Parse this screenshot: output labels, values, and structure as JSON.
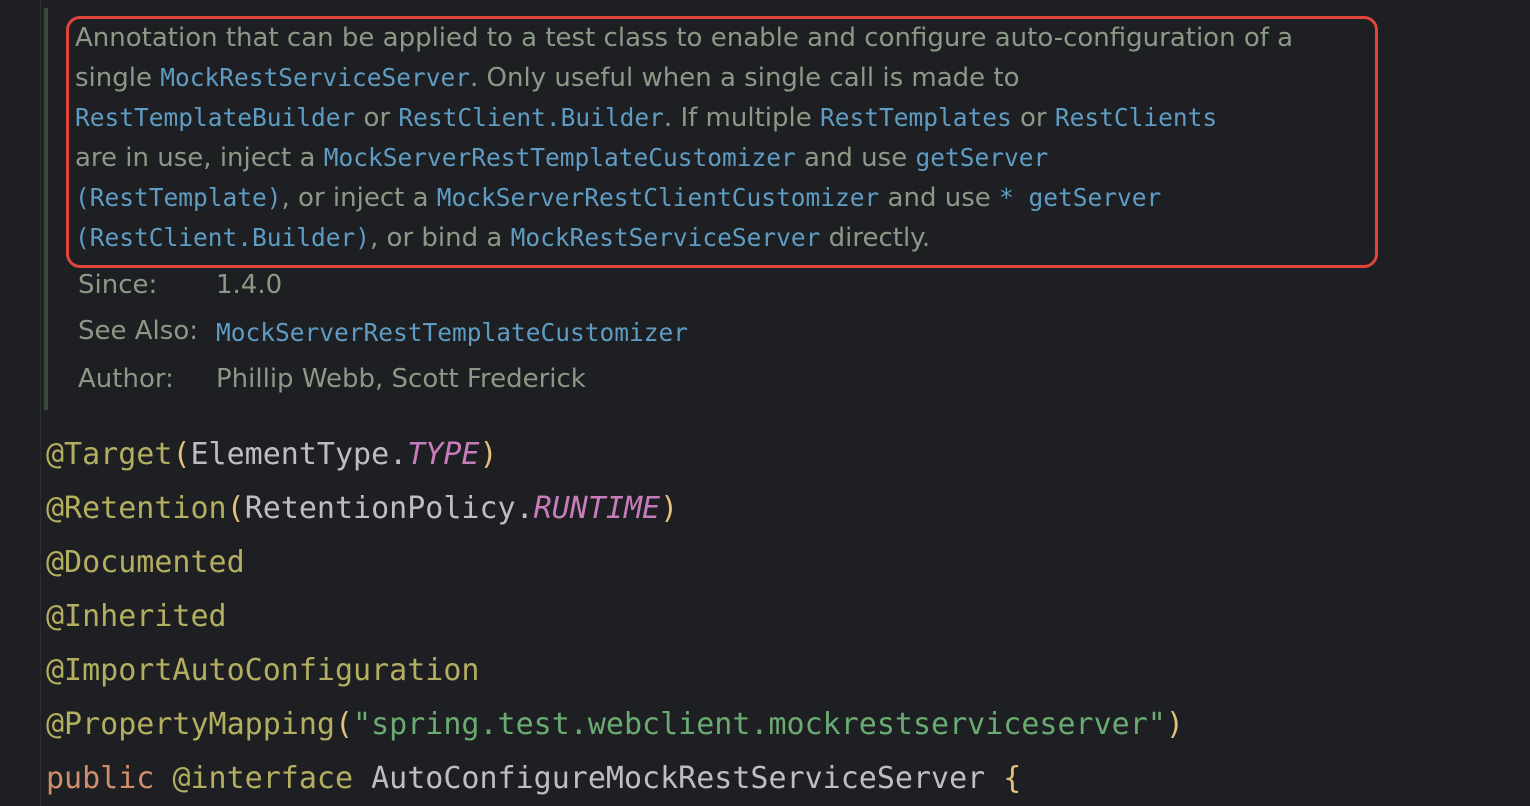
{
  "javadoc": {
    "lines": [
      [
        {
          "t": "Annotation that can be applied to a test class to enable and configure auto-configuration of a",
          "k": "text"
        }
      ],
      [
        {
          "t": "single ",
          "k": "text"
        },
        {
          "t": "MockRestServiceServer",
          "k": "code"
        },
        {
          "t": ". Only useful when a single call is made to",
          "k": "text"
        }
      ],
      [
        {
          "t": "RestTemplateBuilder",
          "k": "code"
        },
        {
          "t": " or ",
          "k": "text"
        },
        {
          "t": "RestClient.Builder",
          "k": "code"
        },
        {
          "t": ". If multiple ",
          "k": "text"
        },
        {
          "t": "RestTemplates",
          "k": "code"
        },
        {
          "t": " or ",
          "k": "text"
        },
        {
          "t": "RestClients",
          "k": "code"
        }
      ],
      [
        {
          "t": "are in use, inject a ",
          "k": "text"
        },
        {
          "t": "MockServerRestTemplateCustomizer",
          "k": "code"
        },
        {
          "t": " and use ",
          "k": "text"
        },
        {
          "t": "getServer",
          "k": "code"
        }
      ],
      [
        {
          "t": "(RestTemplate)",
          "k": "code"
        },
        {
          "t": ", or inject a ",
          "k": "text"
        },
        {
          "t": "MockServerRestClientCustomizer",
          "k": "code"
        },
        {
          "t": " and use ",
          "k": "text"
        },
        {
          "t": "* getServer",
          "k": "code"
        }
      ],
      [
        {
          "t": "(RestClient.Builder)",
          "k": "code"
        },
        {
          "t": ", or bind a ",
          "k": "text"
        },
        {
          "t": "MockRestServiceServer",
          "k": "code"
        },
        {
          "t": " directly.",
          "k": "text"
        }
      ]
    ],
    "since_label": "Since:",
    "since_value": "1.4.0",
    "see_also_label": "See Also:",
    "see_also_value": "MockServerRestTemplateCustomizer",
    "author_label": "Author:",
    "author_value": "Phillip Webb, Scott Frederick"
  },
  "code": {
    "line1": {
      "ann": "@Target",
      "open": "(",
      "cls": "ElementType.",
      "const": "TYPE",
      "close": ")"
    },
    "line2": {
      "ann": "@Retention",
      "open": "(",
      "cls": "RetentionPolicy.",
      "const": "RUNTIME",
      "close": ")"
    },
    "line3": {
      "ann": "@Documented"
    },
    "line4": {
      "ann": "@Inherited"
    },
    "line5": {
      "ann": "@ImportAutoConfiguration"
    },
    "line6": {
      "ann": "@PropertyMapping",
      "open": "(",
      "str": "\"spring.test.webclient.mockrestserviceserver\"",
      "close": ")"
    },
    "line7": {
      "kw": "public",
      "ann": "@interface",
      "name": "AutoConfigureMockRestServiceServer",
      "brace": "{"
    }
  },
  "colors": {
    "background": "#1e1f22",
    "doc_text": "#8a9a86",
    "doc_code_ref": "#5f9cc3",
    "highlight_border": "#e0443a",
    "annotation": "#b3ae60",
    "keyword": "#cf8e6d",
    "string": "#6aab73",
    "static_const": "#c77dbb"
  }
}
